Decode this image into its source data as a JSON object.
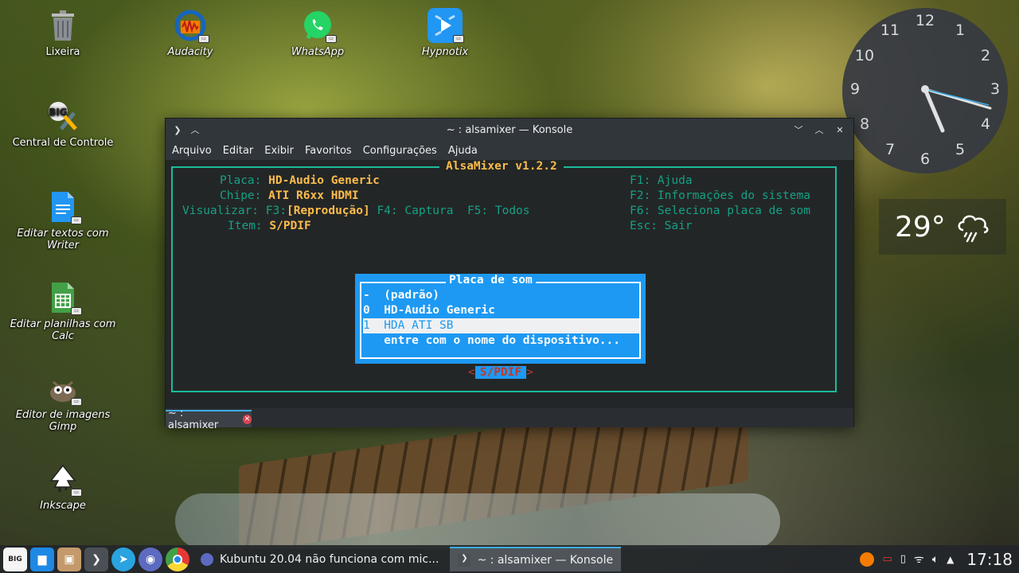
{
  "desktop": {
    "icons": [
      {
        "name": "trash",
        "label": "Lixeira"
      },
      {
        "name": "audacity",
        "label": "Audacity"
      },
      {
        "name": "whatsapp",
        "label": "WhatsApp"
      },
      {
        "name": "hypnotix",
        "label": "Hypnotix"
      },
      {
        "name": "control-center",
        "label": "Central de Controle"
      },
      {
        "name": "writer",
        "label": "Editar textos com Writer"
      },
      {
        "name": "calc",
        "label": "Editar planilhas com Calc"
      },
      {
        "name": "gimp",
        "label": "Editor de imagens Gimp"
      },
      {
        "name": "inkscape",
        "label": "Inkscape"
      }
    ]
  },
  "clock": {
    "numbers": [
      "12",
      "1",
      "2",
      "3",
      "4",
      "5",
      "6",
      "7",
      "8",
      "9",
      "10",
      "11"
    ]
  },
  "weather": {
    "temperature": "29°"
  },
  "window": {
    "title": "~ : alsamixer — Konsole",
    "menu": [
      "Arquivo",
      "Editar",
      "Exibir",
      "Favoritos",
      "Configurações",
      "Ajuda"
    ],
    "tab_label": "~ : alsamixer"
  },
  "alsamixer": {
    "title": "AlsaMixer v1.2.2",
    "card_label": "Placa:",
    "card_value": "HD-Audio Generic",
    "chip_label": "Chipe:",
    "chip_value": "ATI R6xx HDMI",
    "view_label": "Visualizar:",
    "view_f3": "F3:",
    "view_current": "[Reprodução]",
    "view_rest": " F4: Captura  F5: Todos",
    "item_label": "Item:",
    "item_value": "S/PDIF",
    "help": [
      "F1: Ajuda",
      "F2: Informações do sistema",
      "F6: Seleciona placa de som",
      "Esc: Sair"
    ],
    "dialog": {
      "title": "Placa de som",
      "items": [
        "-  (padrão)",
        "0  HD-Audio Generic",
        "1  HDA ATI SB",
        "   entre com o nome do dispositivo..."
      ]
    },
    "control": {
      "left": "<",
      "name": "S/PDIF",
      "right": ">"
    }
  },
  "taskbar": {
    "tasks": [
      {
        "label": "Kubuntu 20.04 não funciona com mic..."
      },
      {
        "label": "~ : alsamixer — Konsole"
      }
    ],
    "time": "17:18"
  }
}
